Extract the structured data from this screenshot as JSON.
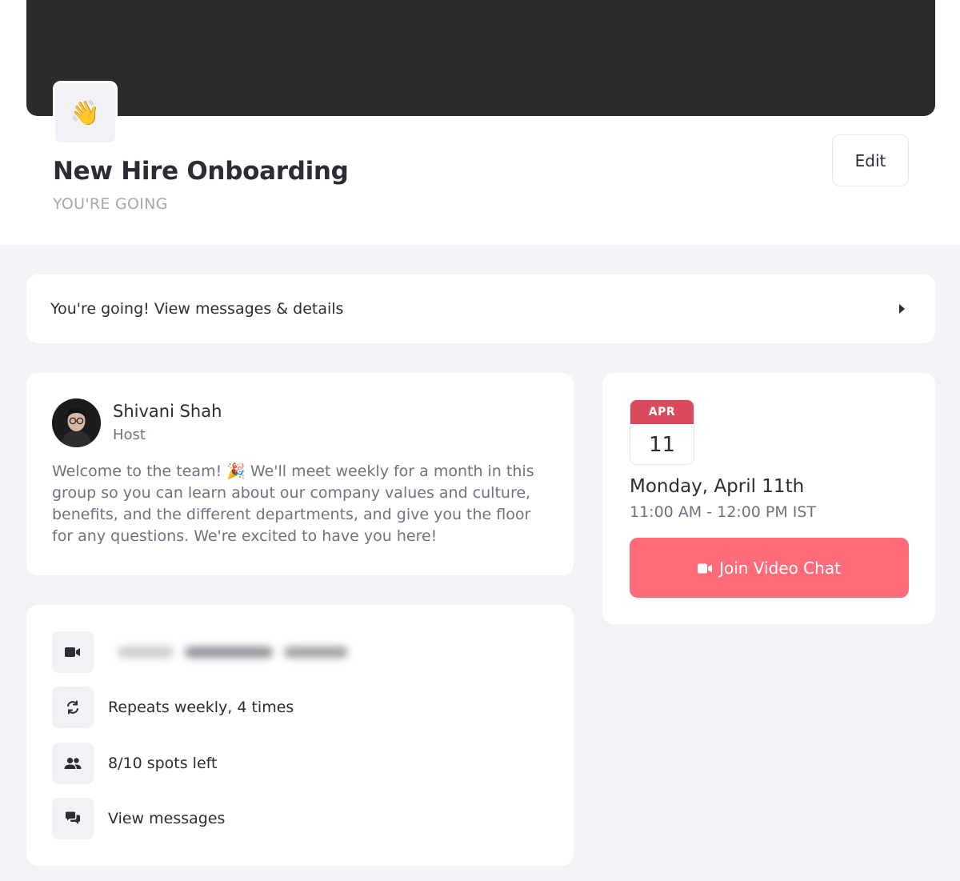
{
  "event": {
    "icon": "waving-hand-emoji",
    "icon_glyph": "👋",
    "title": "New Hire Onboarding",
    "status": "YOU'RE GOING",
    "edit_label": "Edit"
  },
  "details_bar": {
    "label": "You're going! View messages & details",
    "icon": "caret-right-icon"
  },
  "host": {
    "name": "Shivani Shah",
    "role": "Host",
    "description": "Welcome to the team! 🎉 We'll meet weekly for a month in this group so you can learn about our company values and culture, benefits, and the different departments, and give you the floor for any questions. We're excited to have you here!"
  },
  "info_items": [
    {
      "icon": "video-camera-icon",
      "label": ""
    },
    {
      "icon": "repeat-icon",
      "label": "Repeats weekly, 4 times"
    },
    {
      "icon": "people-icon",
      "label": "8/10 spots left"
    },
    {
      "icon": "chat-bubbles-icon",
      "label": "View messages"
    }
  ],
  "schedule": {
    "month": "APR",
    "day": "11",
    "date_label": "Monday, April 11th",
    "time_range": "11:00 AM - 12:00 PM IST",
    "join_label": "Join Video Chat"
  },
  "colors": {
    "accent": "#ff6b78",
    "calendar_red": "#d84a5c",
    "cover": "#2b2b2b",
    "background": "#f2f3f6"
  }
}
